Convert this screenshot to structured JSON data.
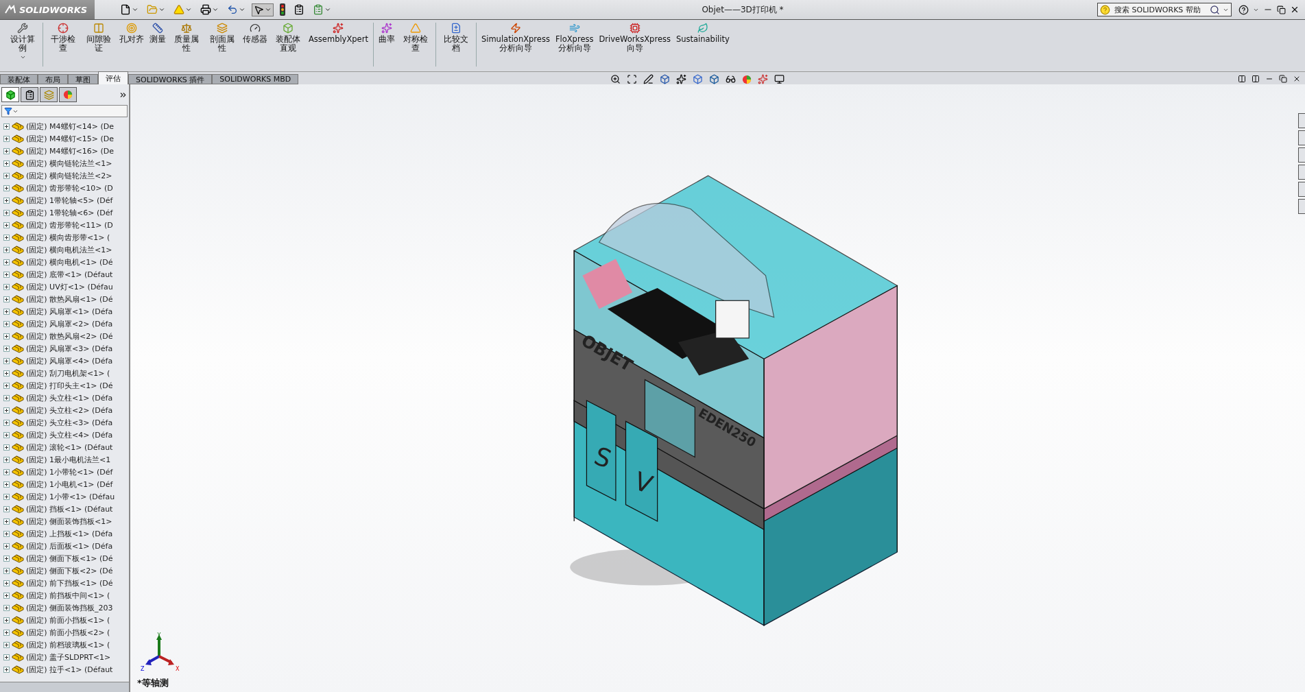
{
  "app": {
    "brand": "SOLIDWORKS"
  },
  "window": {
    "title": "Objet——3D打印机 *"
  },
  "help_search": {
    "placeholder": "搜索 SOLIDWORKS 帮助"
  },
  "ribbon": {
    "groups": [
      [
        {
          "label": "设计算例",
          "has_menu": true
        }
      ],
      [
        {
          "label": "干涉检查",
          "has_menu": false
        },
        {
          "label": "间隙验证",
          "has_menu": false
        },
        {
          "label": "孔对齐",
          "has_menu": false
        },
        {
          "label": "测量",
          "has_menu": false
        },
        {
          "label": "质量属性",
          "has_menu": false
        },
        {
          "label": "剖面属性",
          "has_menu": false
        },
        {
          "label": "传感器",
          "has_menu": false
        },
        {
          "label": "装配体直观",
          "has_menu": false
        },
        {
          "label": "AssemblyXpert",
          "has_menu": false
        }
      ],
      [
        {
          "label": "曲率",
          "has_menu": false
        },
        {
          "label": "对称检查",
          "has_menu": false
        }
      ],
      [
        {
          "label": "比较文档",
          "has_menu": false
        }
      ],
      [
        {
          "label": "SimulationXpress 分析向导",
          "has_menu": false
        },
        {
          "label": "FloXpress 分析向导",
          "has_menu": false
        },
        {
          "label": "DriveWorksXpress 向导",
          "has_menu": false
        },
        {
          "label": "Sustainability",
          "has_menu": false
        }
      ]
    ]
  },
  "tabs": [
    {
      "label": "装配体",
      "selected": false
    },
    {
      "label": "布局",
      "selected": false
    },
    {
      "label": "草图",
      "selected": false
    },
    {
      "label": "评估",
      "selected": true
    },
    {
      "label": "SOLIDWORKS 插件",
      "selected": false
    },
    {
      "label": "SOLIDWORKS MBD",
      "selected": false
    }
  ],
  "tree": {
    "items": [
      "(固定) M4螺钉<14> (De",
      "(固定) M4螺钉<15> (De",
      "(固定) M4螺钉<16> (De",
      "(固定) 横向链轮法兰<1>",
      "(固定) 横向链轮法兰<2>",
      "(固定) 齿形带轮<10> (D",
      "(固定) 1带轮轴<5> (Déf",
      "(固定) 1带轮轴<6> (Déf",
      "(固定) 齿形带轮<11> (D",
      "(固定) 横向齿形带<1> (",
      "(固定) 横向电机法兰<1>",
      "(固定) 横向电机<1> (Dé",
      "(固定) 底带<1> (Défaut",
      "(固定) UV灯<1> (Défau",
      "(固定) 散热风扇<1> (Dé",
      "(固定) 风扇罩<1> (Défa",
      "(固定) 风扇罩<2> (Défa",
      "(固定) 散热风扇<2> (Dé",
      "(固定) 风扇罩<3> (Défa",
      "(固定) 风扇罩<4> (Défa",
      "(固定) 刮刀电机架<1> (",
      "(固定) 打印头主<1> (Dé",
      "(固定) 头立柱<1> (Défa",
      "(固定) 头立柱<2> (Défa",
      "(固定) 头立柱<3> (Défa",
      "(固定) 头立柱<4> (Défa",
      "(固定) 滚轮<1> (Défaut",
      "(固定) 1最小电机法兰<1",
      "(固定) 1小带轮<1> (Déf",
      "(固定) 1小电机<1> (Déf",
      "(固定) 1小带<1> (Défau",
      "(固定) 挡板<1> (Défaut",
      "(固定) 侧面装饰挡板<1>",
      "(固定) 上挡板<1> (Défa",
      "(固定) 后面板<1> (Défa",
      "(固定) 侧面下板<1> (Dé",
      "(固定) 侧面下板<2> (Dé",
      "(固定) 前下挡板<1> (Dé",
      "(固定) 前挡板中间<1> (",
      "(固定) 侧面装饰挡板_203",
      "(固定) 前面小挡板<1> (",
      "(固定) 前面小挡板<2> (",
      "(固定) 前档玻璃板<1> (",
      "(固定) 盖子SLDPRT<1>",
      "(固定) 拉手<1> (Défaut"
    ]
  },
  "viewport": {
    "model_labels": [
      "OBJET",
      "EDEN250",
      "S",
      "V"
    ],
    "triad": {
      "x": "X",
      "y": "Y",
      "z": "Z"
    },
    "view_name": "*等轴测"
  }
}
